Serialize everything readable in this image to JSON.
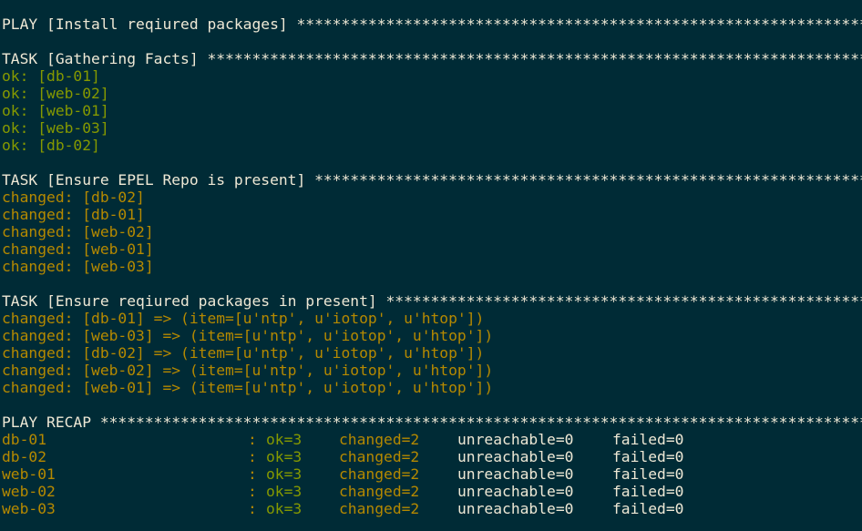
{
  "play": {
    "header": "PLAY [Install reqiured packages] ***********************************************************************************************"
  },
  "tasks": [
    {
      "header": "TASK [Gathering Facts] *****************************************************************************************************",
      "results": [
        {
          "status": "ok",
          "text": "ok: [db-01]"
        },
        {
          "status": "ok",
          "text": "ok: [web-02]"
        },
        {
          "status": "ok",
          "text": "ok: [web-01]"
        },
        {
          "status": "ok",
          "text": "ok: [web-03]"
        },
        {
          "status": "ok",
          "text": "ok: [db-02]"
        }
      ]
    },
    {
      "header": "TASK [Ensure EPEL Repo is present] *****************************************************************************************",
      "results": [
        {
          "status": "changed",
          "text": "changed: [db-02]"
        },
        {
          "status": "changed",
          "text": "changed: [db-01]"
        },
        {
          "status": "changed",
          "text": "changed: [web-02]"
        },
        {
          "status": "changed",
          "text": "changed: [web-01]"
        },
        {
          "status": "changed",
          "text": "changed: [web-03]"
        }
      ]
    },
    {
      "header": "TASK [Ensure reqiured packages in present] *********************************************************************************",
      "results": [
        {
          "status": "changed",
          "text": "changed: [db-01] => (item=[u'ntp', u'iotop', u'htop'])"
        },
        {
          "status": "changed",
          "text": "changed: [web-03] => (item=[u'ntp', u'iotop', u'htop'])"
        },
        {
          "status": "changed",
          "text": "changed: [db-02] => (item=[u'ntp', u'iotop', u'htop'])"
        },
        {
          "status": "changed",
          "text": "changed: [web-02] => (item=[u'ntp', u'iotop', u'htop'])"
        },
        {
          "status": "changed",
          "text": "changed: [web-01] => (item=[u'ntp', u'iotop', u'htop'])"
        }
      ]
    }
  ],
  "recap": {
    "header": "PLAY RECAP *****************************************************************************************************************",
    "rows": [
      {
        "host": "db-01",
        "colon": ":",
        "ok": "ok=3",
        "changed": "changed=2",
        "unreachable": "unreachable=0",
        "failed": "failed=0"
      },
      {
        "host": "db-02",
        "colon": ":",
        "ok": "ok=3",
        "changed": "changed=2",
        "unreachable": "unreachable=0",
        "failed": "failed=0"
      },
      {
        "host": "web-01",
        "colon": ":",
        "ok": "ok=3",
        "changed": "changed=2",
        "unreachable": "unreachable=0",
        "failed": "failed=0"
      },
      {
        "host": "web-02",
        "colon": ":",
        "ok": "ok=3",
        "changed": "changed=2",
        "unreachable": "unreachable=0",
        "failed": "failed=0"
      },
      {
        "host": "web-03",
        "colon": ":",
        "ok": "ok=3",
        "changed": "changed=2",
        "unreachable": "unreachable=0",
        "failed": "failed=0"
      }
    ]
  },
  "colors": {
    "background": "#002b36",
    "default_text": "#eee8d5",
    "ok": "#859900",
    "changed": "#b58900"
  }
}
